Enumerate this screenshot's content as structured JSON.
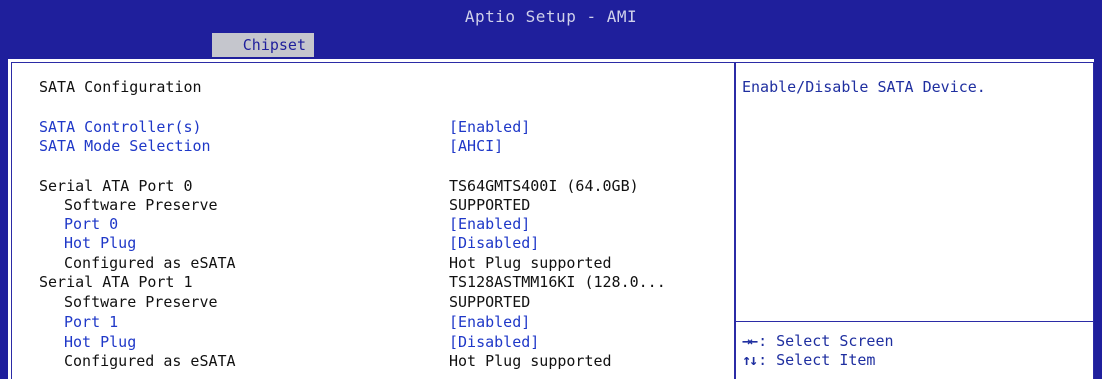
{
  "app_title": "Aptio Setup - AMI",
  "tab": "Chipset",
  "section_title": "SATA Configuration",
  "rows": [
    {
      "label": "SATA Controller(s)",
      "value": "[Enabled]"
    },
    {
      "label": "SATA Mode Selection",
      "value": "[AHCI]"
    },
    {
      "label": "Serial ATA Port 0",
      "value": "TS64GMTS400I   (64.0GB)"
    },
    {
      "label": "Software Preserve",
      "value": "SUPPORTED"
    },
    {
      "label": "Port 0",
      "value": "[Enabled]"
    },
    {
      "label": "Hot Plug",
      "value": "[Disabled]"
    },
    {
      "label": "Configured as eSATA",
      "value": "Hot Plug supported"
    },
    {
      "label": "Serial ATA Port 1",
      "value": "TS128ASTMM16KI (128.0..."
    },
    {
      "label": "Software Preserve",
      "value": "SUPPORTED"
    },
    {
      "label": "Port 1",
      "value": "[Enabled]"
    },
    {
      "label": "Hot Plug",
      "value": "[Disabled]"
    },
    {
      "label": "Configured as eSATA",
      "value": "Hot Plug supported"
    }
  ],
  "help_text": "Enable/Disable SATA Device.",
  "keys": [
    {
      "icon": "left-right-arrows-icon",
      "glyph": "→←",
      "text": ": Select Screen"
    },
    {
      "icon": "up-down-arrows-icon",
      "glyph": "↑↓",
      "text": ": Select Item"
    }
  ],
  "colors": {
    "header_bg": "#1f1f9c",
    "panel_bg": "#ffffff",
    "selectable_text": "#1f38c8",
    "static_text": "#111111",
    "tab_bg": "#c5c6cd"
  }
}
